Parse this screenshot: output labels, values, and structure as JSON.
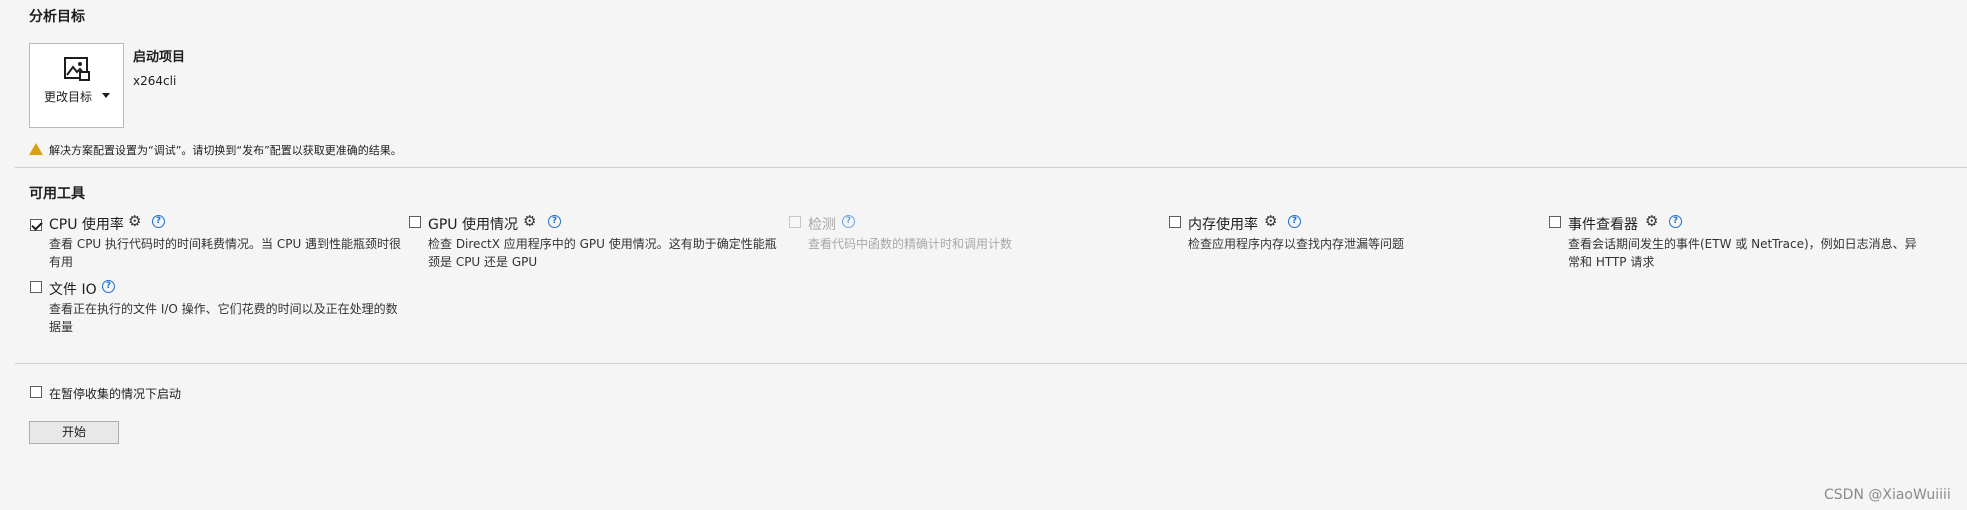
{
  "analysis_target": {
    "section_title": "分析目标",
    "change_target_label": "更改目标",
    "startup_project_label": "启动项目",
    "startup_project_name": "x264cli",
    "warning_text": "解决方案配置设置为“调试”。请切换到“发布”配置以获取更准确的结果。"
  },
  "tools": {
    "section_title": "可用工具",
    "items": [
      {
        "name": "CPU 使用率",
        "checked": true,
        "enabled": true,
        "desc1": "查看 CPU 执行代码时的时间耗费情况。当 CPU 遇到性能瓶颈时很",
        "desc2": "有用"
      },
      {
        "name": "GPU 使用情况",
        "checked": false,
        "enabled": true,
        "desc1": "检查 DirectX 应用程序中的 GPU 使用情况。这有助于确定性能瓶",
        "desc2": "颈是 CPU 还是 GPU"
      },
      {
        "name": "检测",
        "checked": false,
        "enabled": false,
        "desc1": "查看代码中函数的精确计时和调用计数",
        "desc2": ""
      },
      {
        "name": "内存使用率",
        "checked": false,
        "enabled": true,
        "desc1": "检查应用程序内存以查找内存泄漏等问题",
        "desc2": ""
      },
      {
        "name": "事件查看器",
        "checked": false,
        "enabled": true,
        "desc1": "查看会话期间发生的事件(ETW 或 NetTrace)，例如日志消息、异",
        "desc2": "常和 HTTP 请求"
      },
      {
        "name": "文件 IO",
        "checked": false,
        "enabled": true,
        "desc1": "查看正在执行的文件 I/O 操作、它们花费的时间以及正在处理的数",
        "desc2": "据量"
      }
    ]
  },
  "launch_paused_label": "在暂停收集的情况下启动",
  "start_button_label": "开始",
  "watermark": "CSDN @XiaoWuiiii",
  "colors": {
    "background": "#f5f5f5",
    "help_blue": "#1f6fd1",
    "warning": "#d8a10d"
  }
}
